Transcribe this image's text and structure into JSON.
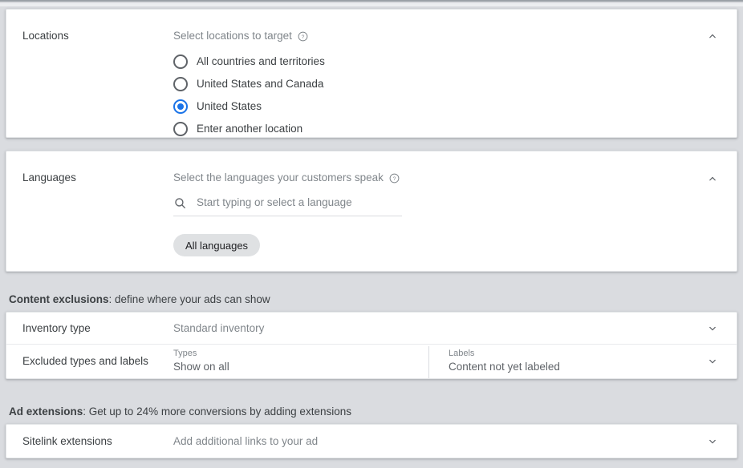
{
  "locations": {
    "label": "Locations",
    "heading": "Select locations to target",
    "help_icon": "help-circle-icon",
    "collapse_icon": "chevron-up-icon",
    "options": [
      {
        "label": "All countries and territories",
        "selected": false
      },
      {
        "label": "United States and Canada",
        "selected": false
      },
      {
        "label": "United States",
        "selected": true
      },
      {
        "label": "Enter another location",
        "selected": false
      }
    ]
  },
  "languages": {
    "label": "Languages",
    "heading": "Select the languages your customers speak",
    "help_icon": "help-circle-icon",
    "collapse_icon": "chevron-up-icon",
    "search_icon": "search-icon",
    "search_value": "",
    "search_placeholder": "Start typing or select a language",
    "chips": [
      {
        "label": "All languages"
      }
    ]
  },
  "content_exclusions": {
    "header_bold": "Content exclusions",
    "header_rest": ": define where your ads can show",
    "rows": [
      {
        "label": "Inventory type",
        "value": "Standard inventory",
        "expand_icon": "chevron-down-icon"
      },
      {
        "label": "Excluded types and labels",
        "expand_icon": "chevron-down-icon",
        "columns": [
          {
            "caption": "Types",
            "value": "Show on all"
          },
          {
            "caption": "Labels",
            "value": "Content not yet labeled"
          }
        ]
      }
    ]
  },
  "ad_extensions": {
    "header_bold": "Ad extensions",
    "header_rest": ": Get up to 24% more conversions by adding extensions",
    "rows": [
      {
        "label": "Sitelink extensions",
        "value": "Add additional links to your ad",
        "expand_icon": "chevron-down-icon"
      }
    ]
  },
  "colors": {
    "accent": "#1a73e8",
    "page_bg": "#dadce0",
    "card_bg": "#ffffff",
    "text_primary": "#3c4043",
    "text_secondary": "#80868b",
    "chip_bg": "#dfe1e3"
  }
}
